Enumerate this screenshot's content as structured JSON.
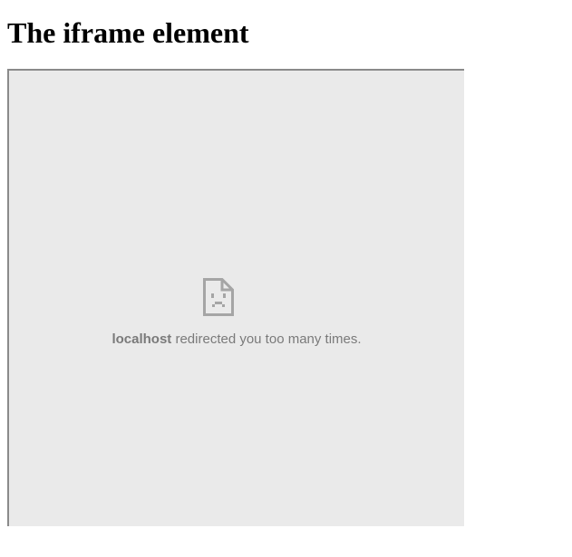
{
  "page": {
    "heading": "The iframe element"
  },
  "iframe": {
    "error": {
      "icon": "sad-page-icon",
      "host": "localhost",
      "message": " redirected you too many times."
    }
  },
  "colors": {
    "frame_background": "#eaeaea",
    "frame_border": "#8a8a8a",
    "error_text": "#7a7a7a",
    "icon": "#a5a5a5"
  }
}
